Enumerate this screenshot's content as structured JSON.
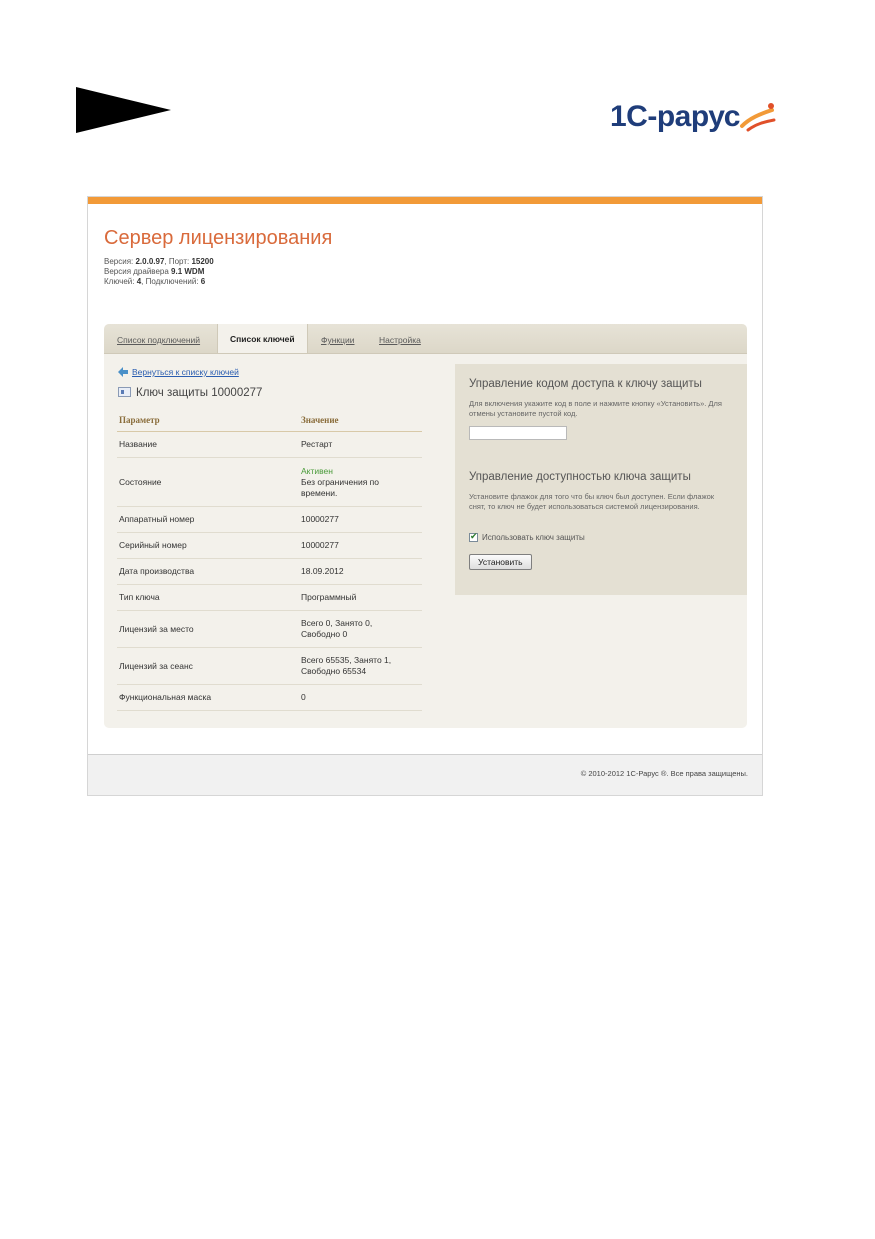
{
  "brand": {
    "logo_text": "1С-рарус"
  },
  "header": {
    "title": "Сервер лицензирования",
    "version_label": "Версия: ",
    "version_value": "2.0.0.97",
    "port_label": ", Порт: ",
    "port_value": "15200",
    "driver_label": "Версия драйвера ",
    "driver_value": "9.1 WDM",
    "keys_label": "Ключей: ",
    "keys_value": "4",
    "connections_label": ", Подключений: ",
    "connections_value": "6"
  },
  "tabs": [
    {
      "label": "Список подключений"
    },
    {
      "label": "Список ключей"
    },
    {
      "label": "Функции"
    },
    {
      "label": "Настройка"
    }
  ],
  "detail": {
    "back_link": "Вернуться к списку ключей",
    "key_title": "Ключ защиты 10000277",
    "col_param": "Параметр",
    "col_value": "Значение",
    "rows": [
      {
        "param": "Название",
        "value": "Рестарт"
      },
      {
        "param": "Состояние",
        "status": "Активен",
        "value": "Без ограничения по времени."
      },
      {
        "param": "Аппаратный номер",
        "value": "10000277"
      },
      {
        "param": "Серийный номер",
        "value": "10000277"
      },
      {
        "param": "Дата производства",
        "value": "18.09.2012"
      },
      {
        "param": "Тип ключа",
        "value": "Программный"
      },
      {
        "param": "Лицензий за место",
        "value": "Всего 0, Занято 0, Свободно 0"
      },
      {
        "param": "Лицензий за сеанс",
        "value": "Всего 65535, Занято 1, Свободно 65534"
      },
      {
        "param": "Функциональная маска",
        "value": "0"
      }
    ]
  },
  "access_code": {
    "title": "Управление кодом доступа к ключу защиты",
    "description": "Для включения укажите код в поле и нажмите кнопку «Установить». Для отмены установите пустой код.",
    "input_value": ""
  },
  "availability": {
    "title": "Управление доступностью ключа защиты",
    "description": "Установите флажок для того что бы ключ был доступен. Если флажок снят, то ключ не будет использоваться системой лицензирования.",
    "checkbox_label": "Использовать ключ защиты",
    "checkbox_checked": true,
    "button_label": "Установить"
  },
  "footer": {
    "copyright": "© 2010-2012 1С-Рарус ®. Все права защищены."
  },
  "colors": {
    "accent_orange": "#f29a38",
    "title_orange": "#d96a3b",
    "link_blue": "#2a5db0",
    "status_green": "#4a9b3a",
    "logo_blue": "#1f3d7a"
  },
  "icons": {
    "arrow_shape": "arrow-shape-icon",
    "back": "arrow-left-icon",
    "key": "key-window-icon",
    "logo_swoosh": "swoosh-icon"
  }
}
